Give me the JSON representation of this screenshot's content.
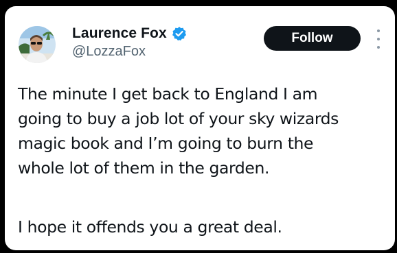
{
  "tweet": {
    "author": {
      "display_name": "Laurence Fox",
      "handle": "@LozzaFox",
      "verified": true,
      "verified_color": "#1d9bf0"
    },
    "follow_button": {
      "label": "Follow"
    },
    "more_menu_icon": "vertical-ellipsis-icon",
    "text_lines": [
      "The minute I get back to England I am",
      "going to buy a job lot of your sky wizards",
      "magic book and I’m going to burn the",
      "whole lot of them in the garden."
    ],
    "text_paragraph_2": "I hope it offends you a great deal."
  }
}
